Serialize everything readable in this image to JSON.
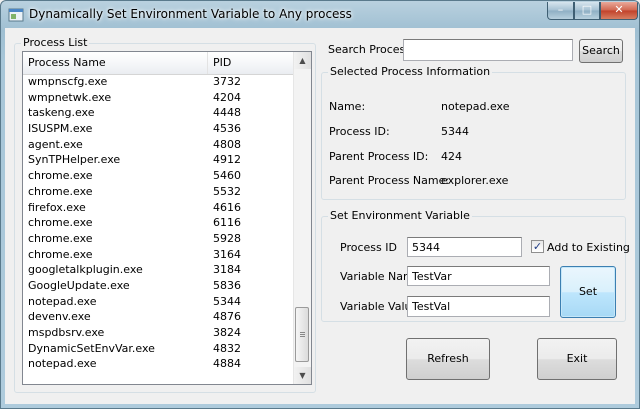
{
  "window": {
    "title": "Dynamically Set Environment Variable to Any process"
  },
  "process_list": {
    "group_label": "Process List",
    "columns": [
      "Process Name",
      "PID"
    ],
    "rows": [
      {
        "name": "wmpnscfg.exe",
        "pid": "3732"
      },
      {
        "name": "wmpnetwk.exe",
        "pid": "4204"
      },
      {
        "name": "taskeng.exe",
        "pid": "4448"
      },
      {
        "name": "ISUSPM.exe",
        "pid": "4536"
      },
      {
        "name": "agent.exe",
        "pid": "4808"
      },
      {
        "name": "SynTPHelper.exe",
        "pid": "4912"
      },
      {
        "name": "chrome.exe",
        "pid": "5460"
      },
      {
        "name": "chrome.exe",
        "pid": "5532"
      },
      {
        "name": "firefox.exe",
        "pid": "4616"
      },
      {
        "name": "chrome.exe",
        "pid": "6116"
      },
      {
        "name": "chrome.exe",
        "pid": "5928"
      },
      {
        "name": "chrome.exe",
        "pid": "3164"
      },
      {
        "name": "googletalkplugin.exe",
        "pid": "3184"
      },
      {
        "name": "GoogleUpdate.exe",
        "pid": "5836"
      },
      {
        "name": "notepad.exe",
        "pid": "5344"
      },
      {
        "name": "devenv.exe",
        "pid": "4876"
      },
      {
        "name": "mspdbsrv.exe",
        "pid": "3824"
      },
      {
        "name": "DynamicSetEnvVar.exe",
        "pid": "4832"
      },
      {
        "name": "notepad.exe",
        "pid": "4884"
      }
    ]
  },
  "search": {
    "label": "Search Process",
    "value": "",
    "button_label": "Search"
  },
  "selected_info": {
    "group_label": "Selected Process Information",
    "name_label": "Name:",
    "name_value": "notepad.exe",
    "pid_label": "Process ID:",
    "pid_value": "5344",
    "ppid_label": "Parent Process ID:",
    "ppid_value": "424",
    "pname_label": "Parent Process Name:",
    "pname_value": "explorer.exe"
  },
  "set_env": {
    "group_label": "Set Environment Variable",
    "pid_label": "Process ID",
    "pid_value": "5344",
    "add_label": "Add to Existing",
    "add_checked": true,
    "var_name_label": "Variable Name",
    "var_name_value": "TestVar",
    "var_value_label": "Variable Value",
    "var_value_value": "TestVal",
    "set_button_label": "Set"
  },
  "actions": {
    "refresh_label": "Refresh",
    "exit_label": "Exit"
  },
  "checkmark": "✓",
  "scroll_arrows": {
    "up": "▲",
    "down": "▼"
  },
  "caption_buttons": {
    "minimize": "–",
    "maximize": "□",
    "close": "✕"
  }
}
